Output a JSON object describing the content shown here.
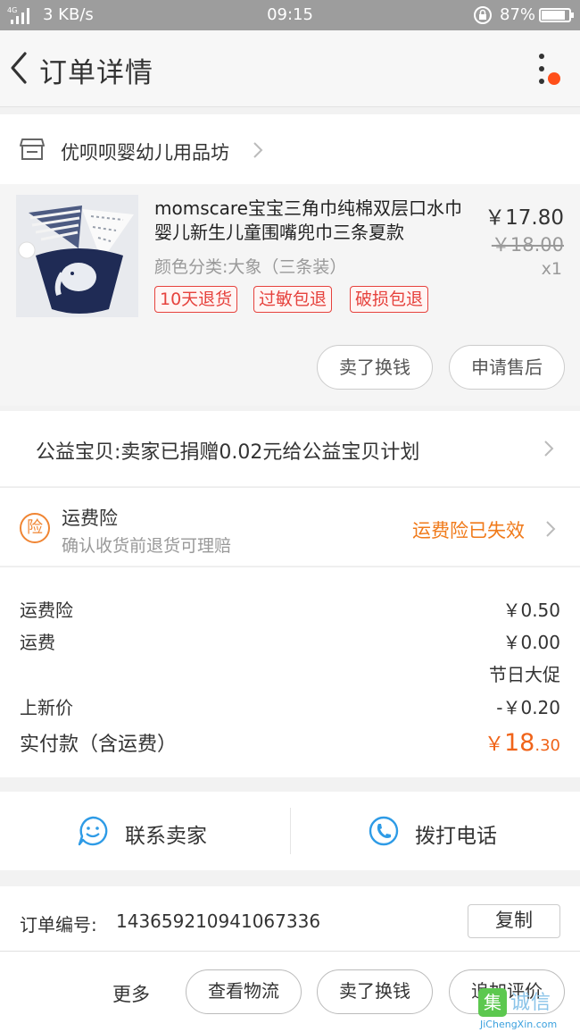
{
  "status_bar": {
    "network": "4G",
    "speed": "3 KB/s",
    "time": "09:15",
    "battery": "87%",
    "battery_level": 0.87
  },
  "header": {
    "title": "订单详情"
  },
  "store": {
    "name": "优呗呗婴幼儿用品坊"
  },
  "product": {
    "title": "momscare宝宝三角巾纯棉双层口水巾婴儿新生儿童围嘴兜巾三条夏款",
    "sku": "颜色分类:大象（三条装）",
    "price": "￥17.80",
    "original_price": "￥18.00",
    "quantity": "x1",
    "tags": [
      "10天退货",
      "过敏包退",
      "破损包退"
    ],
    "buttons": {
      "sell": "卖了换钱",
      "after_sale": "申请售后"
    }
  },
  "charity": {
    "text": "公益宝贝:卖家已捐赠0.02元给公益宝贝计划"
  },
  "insurance": {
    "badge": "险",
    "title": "运费险",
    "subtitle": "确认收货前退货可理赔",
    "status": "运费险已失效"
  },
  "fees": {
    "insurance_label": "运费险",
    "insurance_value": "￥0.50",
    "shipping_label": "运费",
    "shipping_value": "￥0.00",
    "promo_note": "节日大促",
    "discount_label": "上新价",
    "discount_value": "-￥0.20",
    "total_label": "实付款（含运费）",
    "total_symbol": "￥",
    "total_int": "18",
    "total_dec": ".30"
  },
  "contact": {
    "seller": "联系卖家",
    "phone": "拨打电话"
  },
  "order": {
    "number_label": "订单编号:",
    "number_value": "143659210941067336",
    "copy": "复制"
  },
  "bottom_bar": {
    "more": "更多",
    "logistics": "查看物流",
    "sell": "卖了换钱",
    "review": "追加评价"
  },
  "watermark": {
    "mark": "集",
    "text": "诚信",
    "url": "JiChengXin.com"
  },
  "colors": {
    "accent_orange": "#f07a1a",
    "tag_red": "#e6423d",
    "icon_blue": "#2e9be6",
    "notification_dot": "#ff4f1a"
  }
}
